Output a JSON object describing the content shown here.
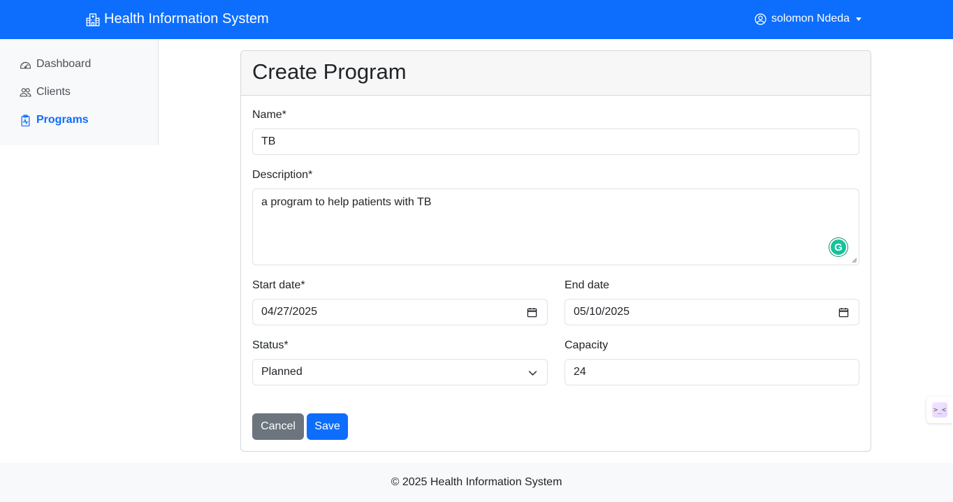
{
  "navbar": {
    "brand": "Health Information System",
    "user_name": "solomon Ndeda"
  },
  "sidebar": {
    "items": [
      {
        "label": "Dashboard",
        "icon": "speedometer-icon",
        "active": false
      },
      {
        "label": "Clients",
        "icon": "people-icon",
        "active": false
      },
      {
        "label": "Programs",
        "icon": "clipboard-pulse-icon",
        "active": true
      }
    ]
  },
  "form": {
    "title": "Create Program",
    "name_label": "Name*",
    "name_value": "TB",
    "description_label": "Description*",
    "description_value": "a program to help patients with TB",
    "start_date_label": "Start date*",
    "start_date_value": "04/27/2025",
    "end_date_label": "End date",
    "end_date_value": "05/10/2025",
    "status_label": "Status*",
    "status_value": "Planned",
    "capacity_label": "Capacity",
    "capacity_value": "24",
    "cancel_label": "Cancel",
    "save_label": "Save"
  },
  "footer": {
    "text": "© 2025 Health Information System"
  },
  "colors": {
    "primary": "#0d6efd",
    "secondary": "#6c757d",
    "light": "#f8f9fa"
  }
}
